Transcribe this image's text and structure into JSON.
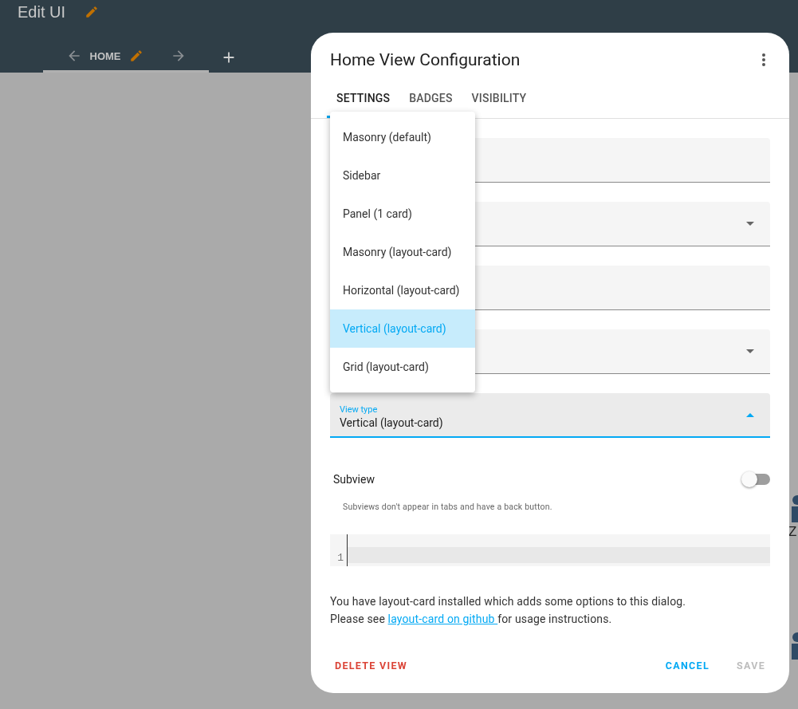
{
  "header": {
    "title": "Edit UI"
  },
  "view_tabs": [
    {
      "label": "HOME",
      "selected": true
    }
  ],
  "dialog": {
    "title": "Home View Configuration",
    "tabs": [
      {
        "label": "SETTINGS",
        "selected": true
      },
      {
        "label": "BADGES",
        "selected": false
      },
      {
        "label": "VISIBILITY",
        "selected": false
      }
    ],
    "fields": [
      {
        "kind": "text"
      },
      {
        "kind": "select"
      },
      {
        "kind": "text"
      },
      {
        "kind": "select"
      },
      {
        "kind": "select",
        "label": "View type",
        "value": "Vertical (layout-card)",
        "focused": true
      }
    ],
    "menu": [
      {
        "label": "Masonry (default)",
        "selected": false
      },
      {
        "label": "Sidebar",
        "selected": false
      },
      {
        "label": "Panel (1 card)",
        "selected": false
      },
      {
        "label": "Masonry (layout-card)",
        "selected": false
      },
      {
        "label": "Horizontal (layout-card)",
        "selected": false
      },
      {
        "label": "Vertical (layout-card)",
        "selected": true
      },
      {
        "label": "Grid (layout-card)",
        "selected": false
      }
    ],
    "subview": {
      "label": "Subview",
      "on": false,
      "hint": "Subviews don't appear in tabs and have a back button."
    },
    "code_editor": {
      "line_numbers": [
        "1"
      ]
    },
    "notice": {
      "line1": "You have layout-card installed which adds some options to this dialog.",
      "before_link": "Please see ",
      "link": "layout-card on github ",
      "after_link": "for usage instructions."
    },
    "buttons": [
      {
        "label": "DELETE VIEW",
        "kind": "danger"
      },
      {
        "label": "CANCEL",
        "kind": "primary"
      },
      {
        "label": "SAVE",
        "kind": "disabled"
      }
    ]
  },
  "background": {
    "fragment": "Z"
  }
}
